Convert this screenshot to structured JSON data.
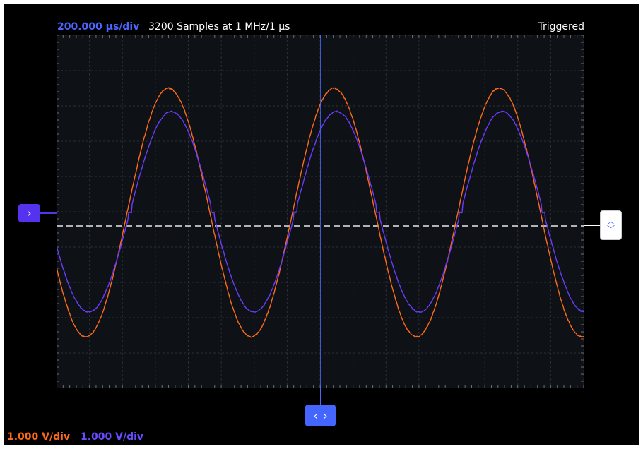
{
  "header": {
    "time_div": "200.000 µs/div",
    "samples": "3200 Samples at 1 MHz/1 µs",
    "status": "Triggered"
  },
  "footer": {
    "ch1_vdiv": "1.000 V/div",
    "ch2_vdiv": "1.000 V/div"
  },
  "colors": {
    "ch1": "#ff6a1a",
    "ch2": "#6a3cff",
    "cursor": "#4a66ff",
    "grid_bg": "#0e1116"
  },
  "controls": {
    "channel_marker_icon": "chevron-right-icon",
    "trigger_level_icons": [
      "chevron-up-icon",
      "chevron-down-icon"
    ],
    "time_cursor_icons": [
      "chevron-left-icon",
      "chevron-right-icon"
    ]
  }
}
